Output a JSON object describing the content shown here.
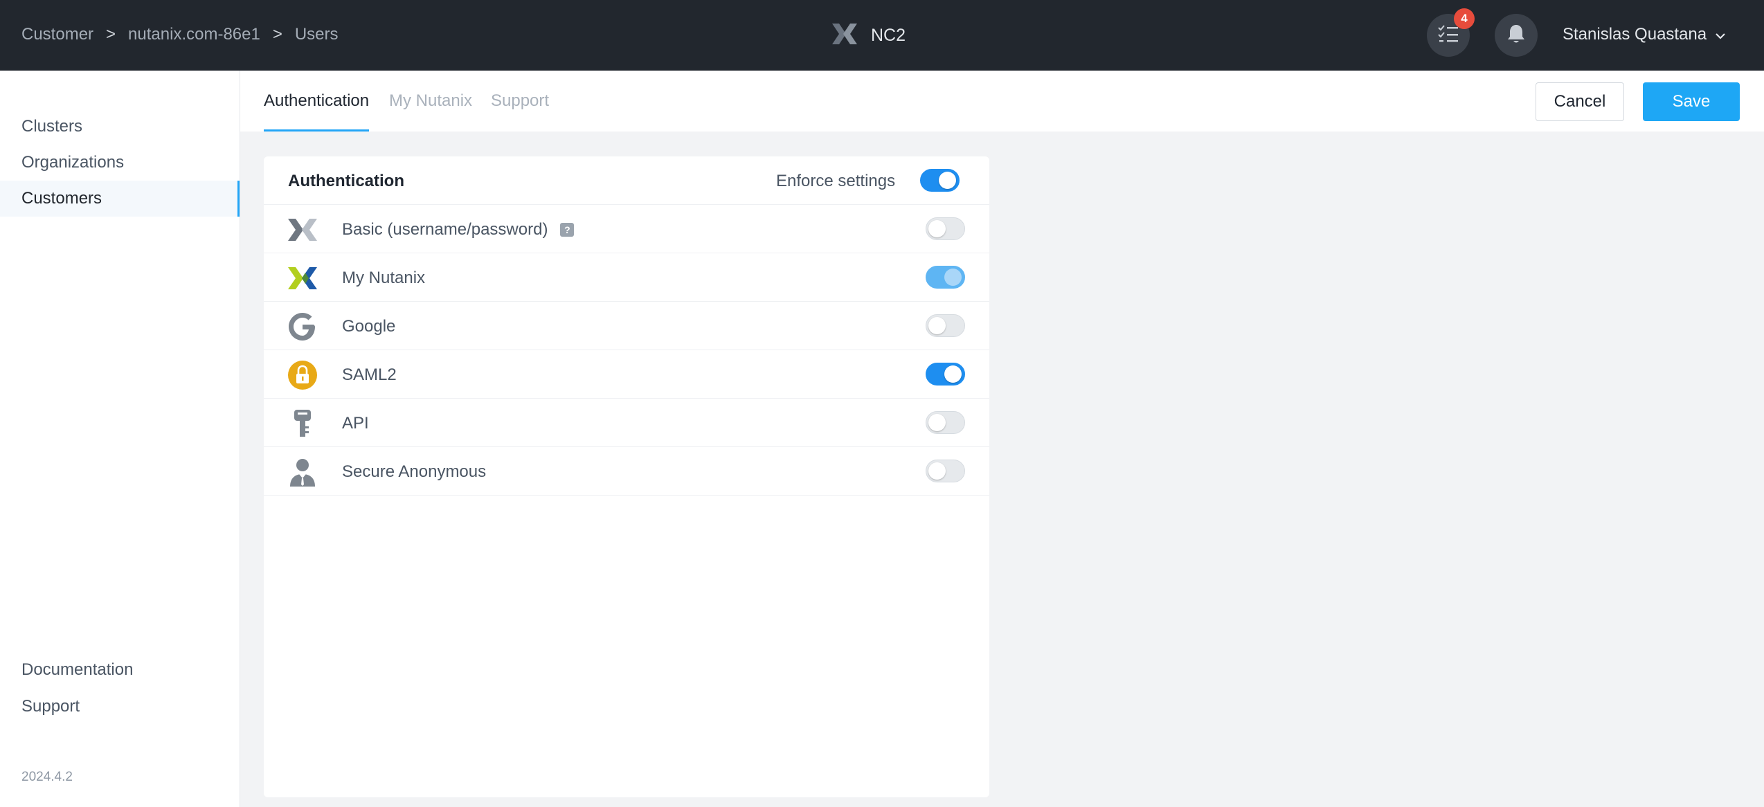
{
  "breadcrumb": [
    "Customer",
    "nutanix.com-86e1",
    "Users"
  ],
  "breadcrumb_separator": ">",
  "brand": {
    "name": "NC2"
  },
  "header": {
    "task_count": "4",
    "user_name": "Stanislas Quastana"
  },
  "sidebar": {
    "items": [
      {
        "label": "Clusters",
        "active": false
      },
      {
        "label": "Organizations",
        "active": false
      },
      {
        "label": "Customers",
        "active": true
      }
    ],
    "bottom_items": [
      {
        "label": "Documentation"
      },
      {
        "label": "Support"
      }
    ],
    "version": "2024.4.2"
  },
  "tabs": [
    {
      "label": "Authentication",
      "active": true
    },
    {
      "label": "My Nutanix",
      "active": false
    },
    {
      "label": "Support",
      "active": false
    }
  ],
  "actions": {
    "cancel": "Cancel",
    "save": "Save"
  },
  "panel": {
    "title": "Authentication",
    "enforce_label": "Enforce settings",
    "enforce_enabled": true,
    "methods": [
      {
        "label": "Basic (username/password)",
        "icon": "nutanix-x-gray-icon",
        "enabled": false,
        "help": "?"
      },
      {
        "label": "My Nutanix",
        "icon": "nutanix-x-color-icon",
        "enabled": true,
        "disabled_state": true
      },
      {
        "label": "Google",
        "icon": "google-g-icon",
        "enabled": false
      },
      {
        "label": "SAML2",
        "icon": "lock-icon",
        "enabled": true
      },
      {
        "label": "API",
        "icon": "key-icon",
        "enabled": false
      },
      {
        "label": "Secure Anonymous",
        "icon": "anonymous-user-icon",
        "enabled": false
      }
    ]
  },
  "colors": {
    "accent": "#1ea7f5",
    "topbar": "#22272e",
    "badge": "#e74c3c",
    "saml_lock": "#e8a917"
  }
}
